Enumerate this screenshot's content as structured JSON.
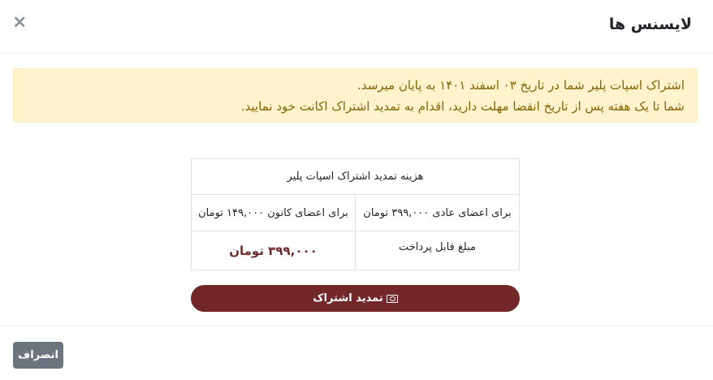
{
  "modal": {
    "title": "لایسنس ها",
    "close_symbol": "×"
  },
  "alert": {
    "line1": "اشتراک اسپات پلیر شما در تاریخ ۰۳ اسفند ۱۴۰۱ به پایان میرسد.",
    "line2": "شما تا یک هفته پس از تاریخ انقضا مهلت دارید، اقدام به تمدید اشتراک اکانت خود نمایید.",
    "color": "#856404",
    "background": "#fff3cd"
  },
  "pricing": {
    "header": "هزینه تمدید اشتراک اسپات پلیر",
    "regular_members": "برای اعضای عادی ۳۹۹,۰۰۰ تومان",
    "kanoon_members": "برای اعضای کانون ۱۴۹,۰۰۰ تومان",
    "payable_label": "مبلغ قابل پرداخت",
    "payable_amount": "۳۹۹,۰۰۰ تومان"
  },
  "actions": {
    "renew_label": "تمدید اشتراک",
    "renew_icon": "ticket-icon",
    "cancel_label": "انصراف"
  },
  "colors": {
    "accent": "#722828",
    "price": "#6f2c2c",
    "cancel": "#6c757d"
  }
}
